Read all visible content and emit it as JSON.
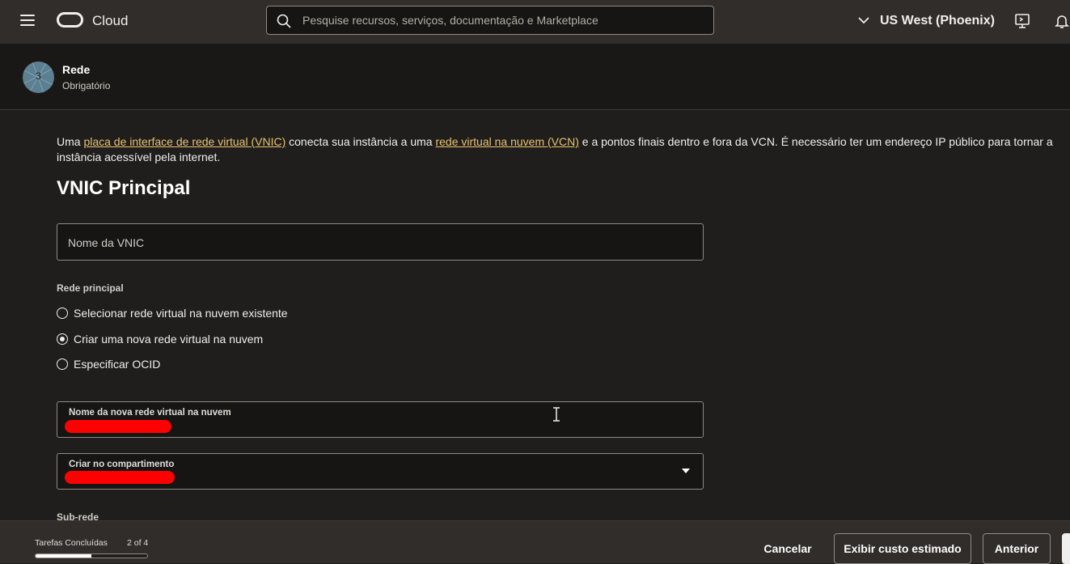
{
  "header": {
    "brand": "Cloud",
    "search_placeholder": "Pesquise recursos, serviços, documentação e Marketplace",
    "region": "US West (Phoenix)"
  },
  "step": {
    "number": "3",
    "title": "Rede",
    "subtitle": "Obrigatório"
  },
  "intro": {
    "part1": "Uma ",
    "link1": "placa de interface de rede virtual (VNIC)",
    "part2": " conecta sua instância a uma ",
    "link2": "rede virtual na nuvem (VCN)",
    "part3": " e a pontos finais dentro e fora da VCN. É necessário ter um endereço IP público para tornar a instância acessível pela internet."
  },
  "section": {
    "heading": "VNIC Principal",
    "vnic_name_placeholder": "Nome da VNIC",
    "network_group_label": "Rede principal",
    "radios": [
      {
        "label": "Selecionar rede virtual na nuvem existente",
        "checked": false
      },
      {
        "label": "Criar uma nova rede virtual na nuvem",
        "checked": true
      },
      {
        "label": "Especificar OCID",
        "checked": false
      }
    ],
    "new_vcn_label": "Nome da nova rede virtual na nuvem",
    "compartment_label": "Criar no compartimento",
    "subnet_label": "Sub-rede"
  },
  "footer": {
    "tasks_label": "Tarefas Concluídas",
    "tasks_count": "2 of 4",
    "progress": 0.5,
    "cancel_label": "Cancelar",
    "estimate_label": "Exibir custo estimado",
    "previous_label": "Anterior"
  },
  "colors": {
    "link": "#e6c270",
    "redaction": "#ff0000",
    "topbar": "#312d2a"
  }
}
